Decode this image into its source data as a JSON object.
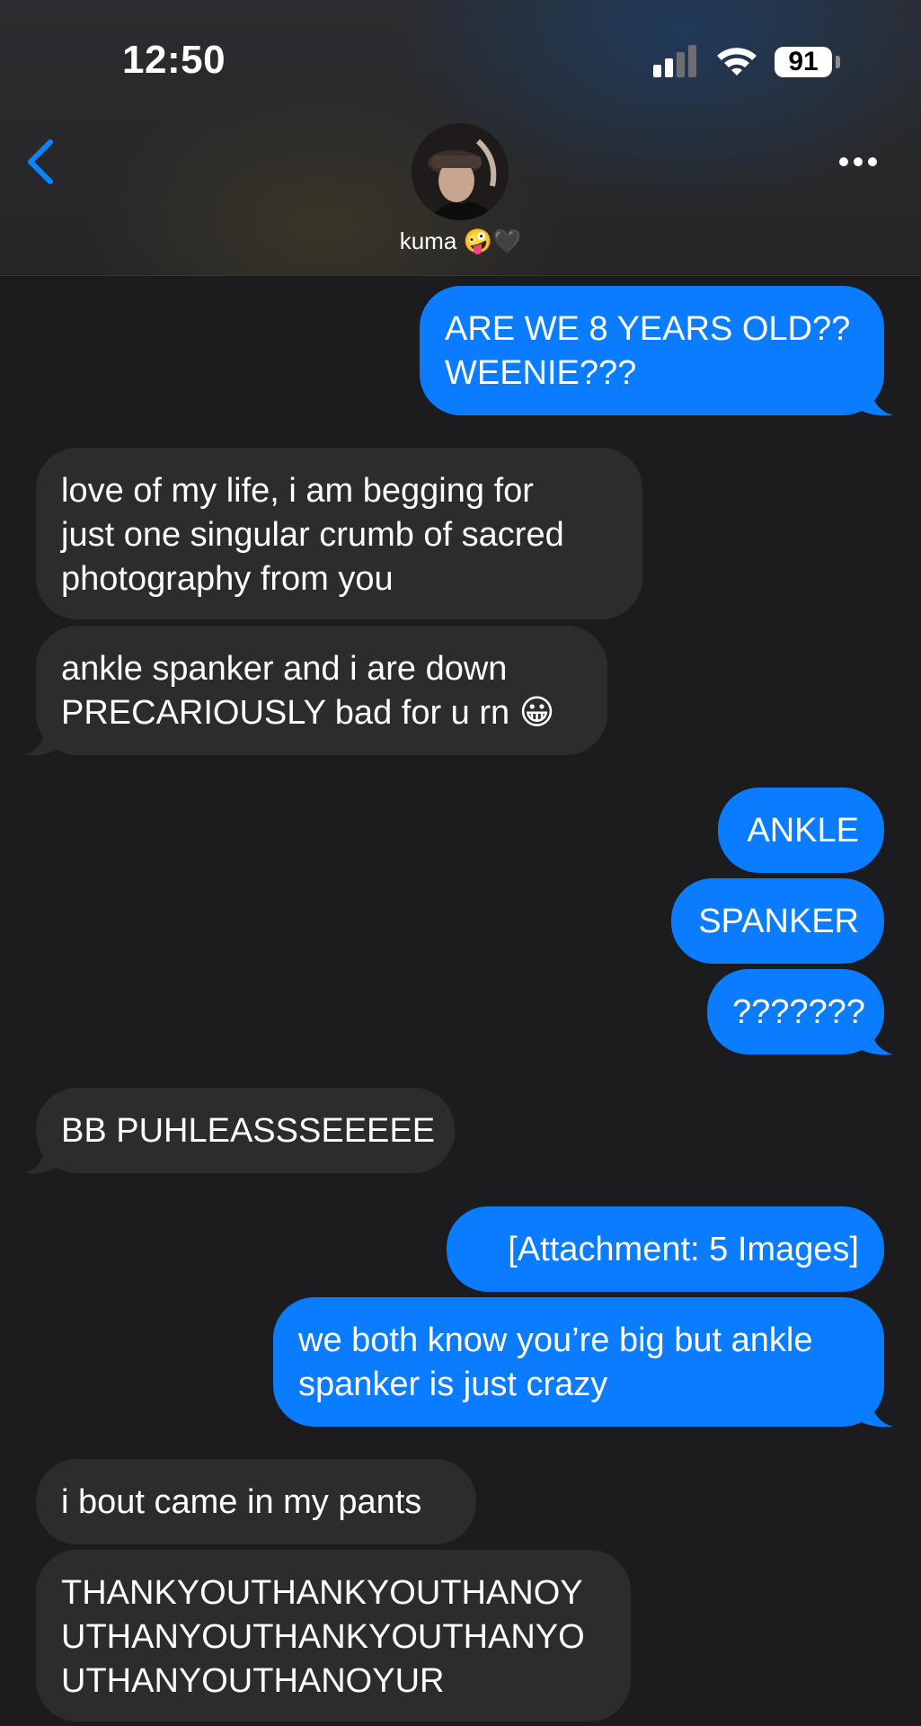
{
  "status_bar": {
    "time": "12:50",
    "battery": "91"
  },
  "header": {
    "contact_name": "kuma 🤪🖤"
  },
  "messages": [
    {
      "direction": "outgoing",
      "lines": [
        "ARE WE 8 YEARS OLD??",
        "WEENIE???"
      ]
    },
    {
      "direction": "incoming",
      "lines": [
        "love of my life, i am begging for",
        "just one singular crumb of sacred",
        "photography from you"
      ]
    },
    {
      "direction": "incoming",
      "lines": [
        "ankle spanker and i are down",
        "PRECARIOUSLY bad for u rn 😀"
      ]
    },
    {
      "direction": "outgoing",
      "lines": [
        "ANKLE"
      ]
    },
    {
      "direction": "outgoing",
      "lines": [
        "SPANKER"
      ]
    },
    {
      "direction": "outgoing",
      "lines": [
        "???????"
      ]
    },
    {
      "direction": "incoming",
      "lines": [
        "BB PUHLEASSSEEEEE"
      ]
    },
    {
      "direction": "outgoing",
      "lines": [
        "[Attachment: 5 Images]"
      ]
    },
    {
      "direction": "outgoing",
      "lines": [
        "we both know you’re big but ankle",
        "spanker is just crazy"
      ]
    },
    {
      "direction": "incoming",
      "lines": [
        "i bout came in my pants"
      ]
    },
    {
      "direction": "incoming",
      "lines": [
        "THANKYOUTHANKYOUTHANOY",
        "UTHANYOUTHANKYOUTHANYO",
        "UTHANYOUTHANOYUR"
      ]
    }
  ],
  "colors": {
    "outgoing_bubble": "#0a7cff",
    "incoming_bubble": "#2c2c2e",
    "background": "#1c1c1e",
    "accent": "#0a84ff"
  },
  "icons": [
    "chevron-left-icon",
    "more-icon",
    "signal-icon",
    "wifi-icon",
    "battery-icon"
  ]
}
